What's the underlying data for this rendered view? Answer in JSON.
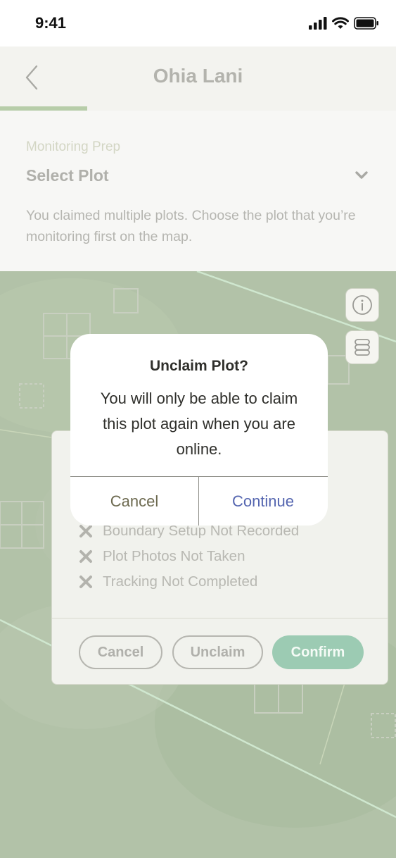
{
  "status_bar": {
    "time": "9:41"
  },
  "header": {
    "title": "Ohia Lani",
    "progress_fraction": 0.22
  },
  "prep": {
    "section_label": "Monitoring Prep",
    "select_label": "Select Plot",
    "description": "You claimed multiple plots. Choose the plot that you’re monitoring first on the map."
  },
  "map": {
    "buttons": [
      {
        "name": "info-button",
        "icon": "info-icon"
      },
      {
        "name": "layers-button",
        "icon": "layers-icon"
      }
    ]
  },
  "sheet": {
    "checklist": [
      "Boundary Setup Not Recorded",
      "Plot Photos Not Taken",
      "Tracking Not Completed"
    ],
    "buttons": {
      "cancel": "Cancel",
      "unclaim": "Unclaim",
      "confirm": "Confirm"
    }
  },
  "alert": {
    "title": "Unclaim Plot?",
    "message": "You will only be able to claim this plot again when you are online.",
    "cancel_label": "Cancel",
    "continue_label": "Continue"
  },
  "colors": {
    "accent_green": "#9ccbb3",
    "progress_green": "#b7cda9",
    "continue_blue": "#5566b0"
  }
}
